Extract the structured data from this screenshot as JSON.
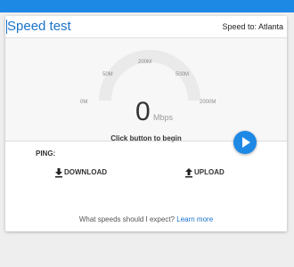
{
  "app": {
    "title": "Speed test",
    "server_label": "Speed to: Atlanta"
  },
  "gauge": {
    "ticks": [
      "0M",
      "50M",
      "200M",
      "500M",
      "2000M"
    ],
    "value": "0",
    "unit": "Mbps",
    "hint": "Click button to begin"
  },
  "controls": {
    "start_icon": "play-icon",
    "accent_color": "#1e88e5"
  },
  "results": {
    "ping_label": "PING:",
    "ping_value": "",
    "download_label": "DOWNLOAD",
    "download_icon": "download-icon",
    "upload_label": "UPLOAD",
    "upload_icon": "upload-icon"
  },
  "footer": {
    "question": "What speeds should I expect?",
    "link": "Learn more"
  }
}
